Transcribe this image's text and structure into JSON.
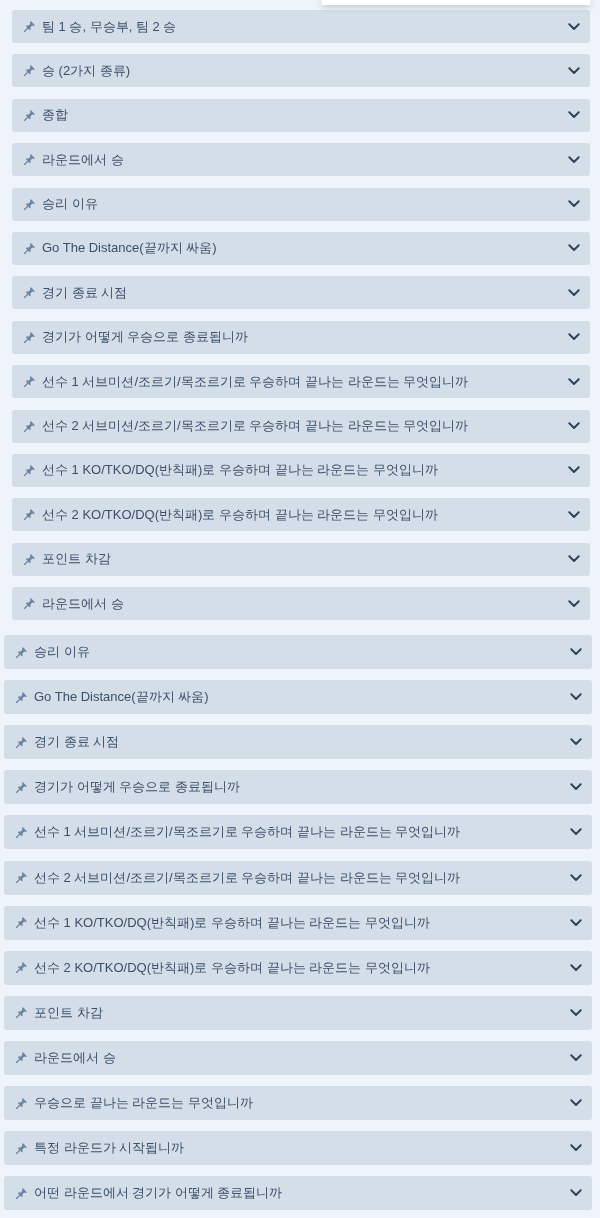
{
  "groups": [
    {
      "kind": "inset",
      "items": [
        {
          "label": "팀 1 승, 무승부, 팀 2 승",
          "expanded": false
        },
        {
          "label": "승 (2가지 종류)",
          "expanded": false
        },
        {
          "label": "종합",
          "expanded": false
        },
        {
          "label": "라운드에서 승",
          "expanded": false
        },
        {
          "label": "승리 이유",
          "expanded": false
        },
        {
          "label": "Go The Distance(끝까지 싸움)",
          "expanded": false
        },
        {
          "label": "경기 종료 시점",
          "expanded": false
        },
        {
          "label": "경기가 어떻게 우승으로 종료됩니까",
          "expanded": false
        },
        {
          "label": "선수 1 서브미션/조르기/목조르기로 우승하며 끝나는 라운드는 무엇입니까",
          "expanded": false
        },
        {
          "label": "선수 2 서브미션/조르기/목조르기로 우승하며 끝나는 라운드는 무엇입니까",
          "expanded": false
        },
        {
          "label": "선수 1 KO/TKO/DQ(반칙패)로 우승하며 끝나는 라운드는 무엇입니까",
          "expanded": false
        },
        {
          "label": "선수 2 KO/TKO/DQ(반칙패)로 우승하며 끝나는 라운드는 무엇입니까",
          "expanded": false
        },
        {
          "label": "포인트 차감",
          "expanded": false
        },
        {
          "label": "라운드에서 승",
          "expanded": false
        }
      ]
    },
    {
      "kind": "full",
      "items": [
        {
          "label": "승리 이유",
          "expanded": false
        },
        {
          "label": "Go The Distance(끝까지 싸움)",
          "expanded": false
        },
        {
          "label": "경기 종료 시점",
          "expanded": false
        },
        {
          "label": "경기가 어떻게 우승으로 종료됩니까",
          "expanded": false
        },
        {
          "label": "선수 1 서브미션/조르기/목조르기로 우승하며 끝나는 라운드는 무엇입니까",
          "expanded": false
        },
        {
          "label": "선수 2 서브미션/조르기/목조르기로 우승하며 끝나는 라운드는 무엇입니까",
          "expanded": false
        },
        {
          "label": "선수 1 KO/TKO/DQ(반칙패)로 우승하며 끝나는 라운드는 무엇입니까",
          "expanded": false
        },
        {
          "label": "선수 2 KO/TKO/DQ(반칙패)로 우승하며 끝나는 라운드는 무엇입니까",
          "expanded": false
        },
        {
          "label": "포인트 차감",
          "expanded": false
        },
        {
          "label": "라운드에서 승",
          "expanded": false
        },
        {
          "label": "우승으로 끝나는 라운드는 무엇입니까",
          "expanded": false
        },
        {
          "label": "특정 라운드가 시작됩니까",
          "expanded": false
        },
        {
          "label": "어떤 라운드에서 경기가 어떻게 종료됩니까",
          "expanded": false
        }
      ]
    }
  ]
}
